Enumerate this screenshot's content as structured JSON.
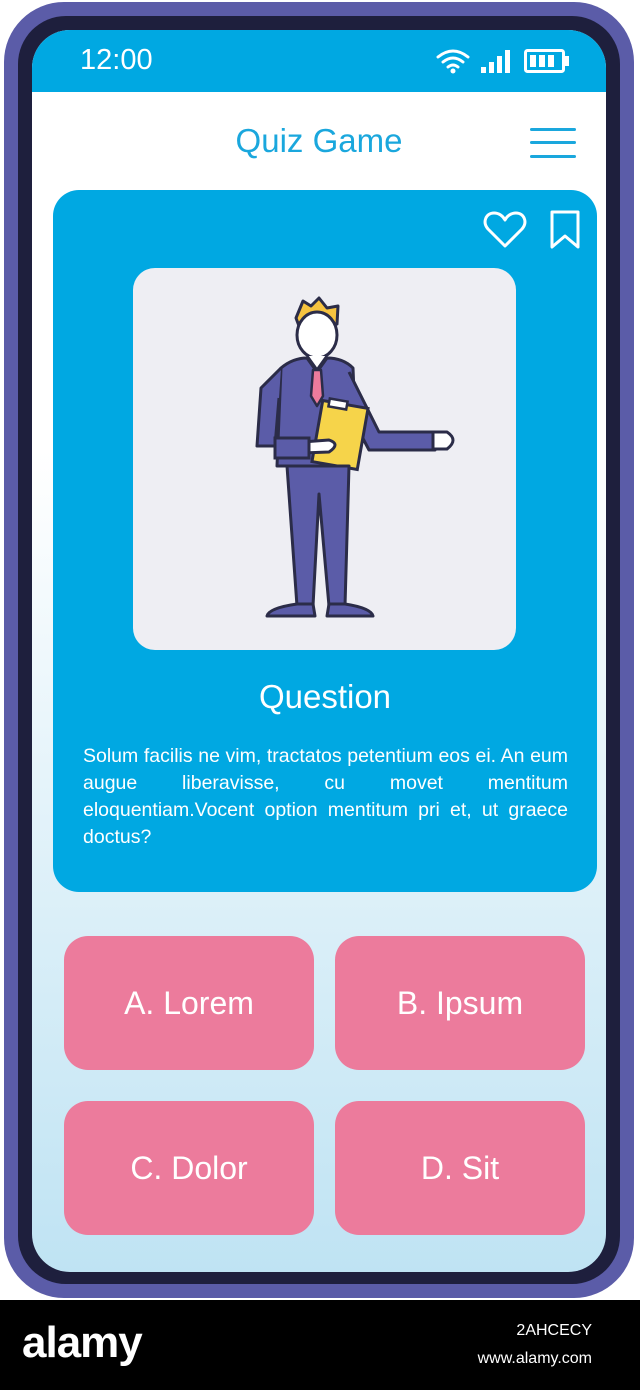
{
  "status_bar": {
    "time": "12:00",
    "icons": [
      "wifi-icon",
      "signal-icon",
      "battery-icon"
    ]
  },
  "header": {
    "title": "Quiz Game",
    "menu_icon": "hamburger-menu-icon"
  },
  "question_card": {
    "actions": [
      "heart-icon",
      "bookmark-icon"
    ],
    "illustration": "businessman-presenting-with-clipboard",
    "title": "Question",
    "text": "Solum facilis ne vim, tractatos petentium eos ei. An eum augue liberavisse, cu movet mentitum eloquentiam.Vocent option mentitum pri et, ut graece doctus?"
  },
  "answers": [
    {
      "label": "A. Lorem"
    },
    {
      "label": "B. Ipsum"
    },
    {
      "label": "C. Dolor"
    },
    {
      "label": "D. Sit"
    }
  ],
  "watermark": {
    "logo": "alamy",
    "image_id": "2AHCECY",
    "url": "www.alamy.com"
  },
  "colors": {
    "phone_frame": "#5b5ca8",
    "accent_blue": "#00a8e2",
    "title_blue": "#1aa7dd",
    "answer_pink": "#ec7b9c",
    "illustration_bg": "#eeeef3"
  }
}
